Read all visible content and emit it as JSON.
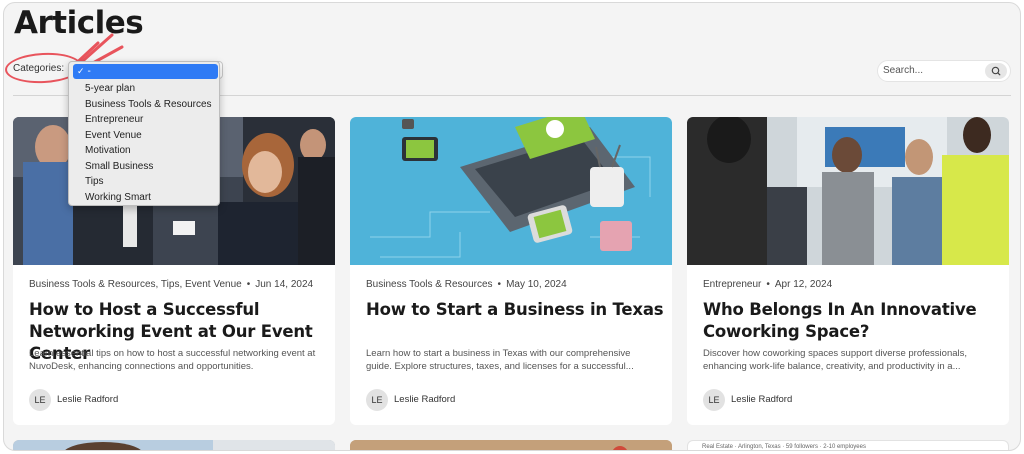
{
  "page": {
    "title": "Articles"
  },
  "filters": {
    "categories_label": "Categories:",
    "selected": "-",
    "options": [
      "5-year plan",
      "Business Tools & Resources",
      "Entrepreneur",
      "Event Venue",
      "Motivation",
      "Small Business",
      "Tips",
      "Working Smart"
    ]
  },
  "search": {
    "placeholder": "Search..."
  },
  "articles": [
    {
      "categories": "Business Tools & Resources,  Tips,  Event Venue",
      "date": "Jun 14, 2024",
      "title": "How to Host a Successful Networking Event at Our Event Center",
      "description": "Learn essential tips on how to host a successful networking event at NuvoDesk, enhancing connections and opportunities.",
      "author_initials": "LE",
      "author": "Leslie Radford"
    },
    {
      "categories": "Business Tools & Resources",
      "date": "May 10, 2024",
      "title": "How to Start a Business in Texas",
      "description": "Learn how to start a business in Texas with our comprehensive guide. Explore structures, taxes, and licenses for a successful...",
      "author_initials": "LE",
      "author": "Leslie Radford"
    },
    {
      "categories": "Entrepreneur",
      "date": "Apr 12, 2024",
      "title": "Who Belongs In An Innovative Coworking Space?",
      "description": "Discover how coworking spaces support diverse professionals, enhancing work-life balance, creativity, and productivity in a...",
      "author_initials": "LE",
      "author": "Leslie Radford"
    }
  ],
  "next_row": {
    "third_card_text": "Real Estate · Arlington, Texas · 59 followers · 2-10 employees"
  },
  "colors": {
    "accent": "#2f7bf5",
    "annotation": "#e8545c",
    "illustration_bg": "#4fb3d9",
    "brand_green": "#8cc63f"
  },
  "icons": {
    "search": "search-icon",
    "check": "check-icon"
  }
}
